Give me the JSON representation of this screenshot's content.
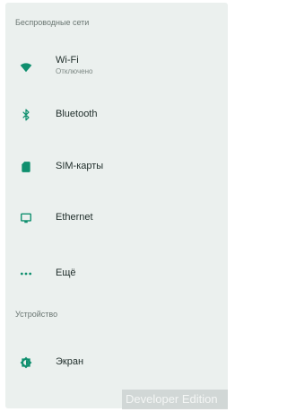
{
  "colors": {
    "accent": "#0f8f6e",
    "background": "#ebf0ee"
  },
  "sections": {
    "wireless": {
      "title": "Беспроводные сети"
    },
    "device": {
      "title": "Устройство"
    }
  },
  "items": {
    "wifi": {
      "label": "Wi-Fi",
      "sublabel": "Отключено",
      "icon": "wifi-icon"
    },
    "bluetooth": {
      "label": "Bluetooth",
      "icon": "bluetooth-icon"
    },
    "sim": {
      "label": "SIM-карты",
      "icon": "sim-card-icon"
    },
    "ethernet": {
      "label": "Ethernet",
      "icon": "ethernet-icon"
    },
    "more": {
      "label": "Ещё",
      "icon": "more-dots-icon"
    },
    "display": {
      "label": "Экран",
      "icon": "brightness-icon"
    }
  },
  "watermark": {
    "text": "Developer Edition"
  }
}
